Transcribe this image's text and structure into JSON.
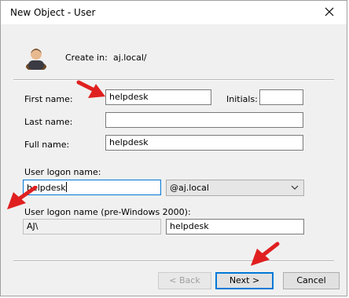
{
  "window": {
    "title": "New Object - User",
    "close_label": "close"
  },
  "header": {
    "create_label": "Create in:",
    "create_value": "aj.local/"
  },
  "fields": {
    "first_name_label": "First name:",
    "first_name_value": "helpdesk",
    "initials_label": "Initials:",
    "initials_value": "",
    "last_name_label": "Last name:",
    "last_name_value": "",
    "full_name_label": "Full name:",
    "full_name_value": "helpdesk",
    "logon_label": "User logon name:",
    "logon_value": "helpdesk",
    "domain_value": "@aj.local",
    "pre2000_label": "User logon name (pre-Windows 2000):",
    "pre2000_domain": "AJ\\",
    "pre2000_value": "helpdesk"
  },
  "buttons": {
    "back": "< Back",
    "next": "Next >",
    "cancel": "Cancel"
  },
  "annotations": {
    "arrow_color": "#e02020"
  }
}
